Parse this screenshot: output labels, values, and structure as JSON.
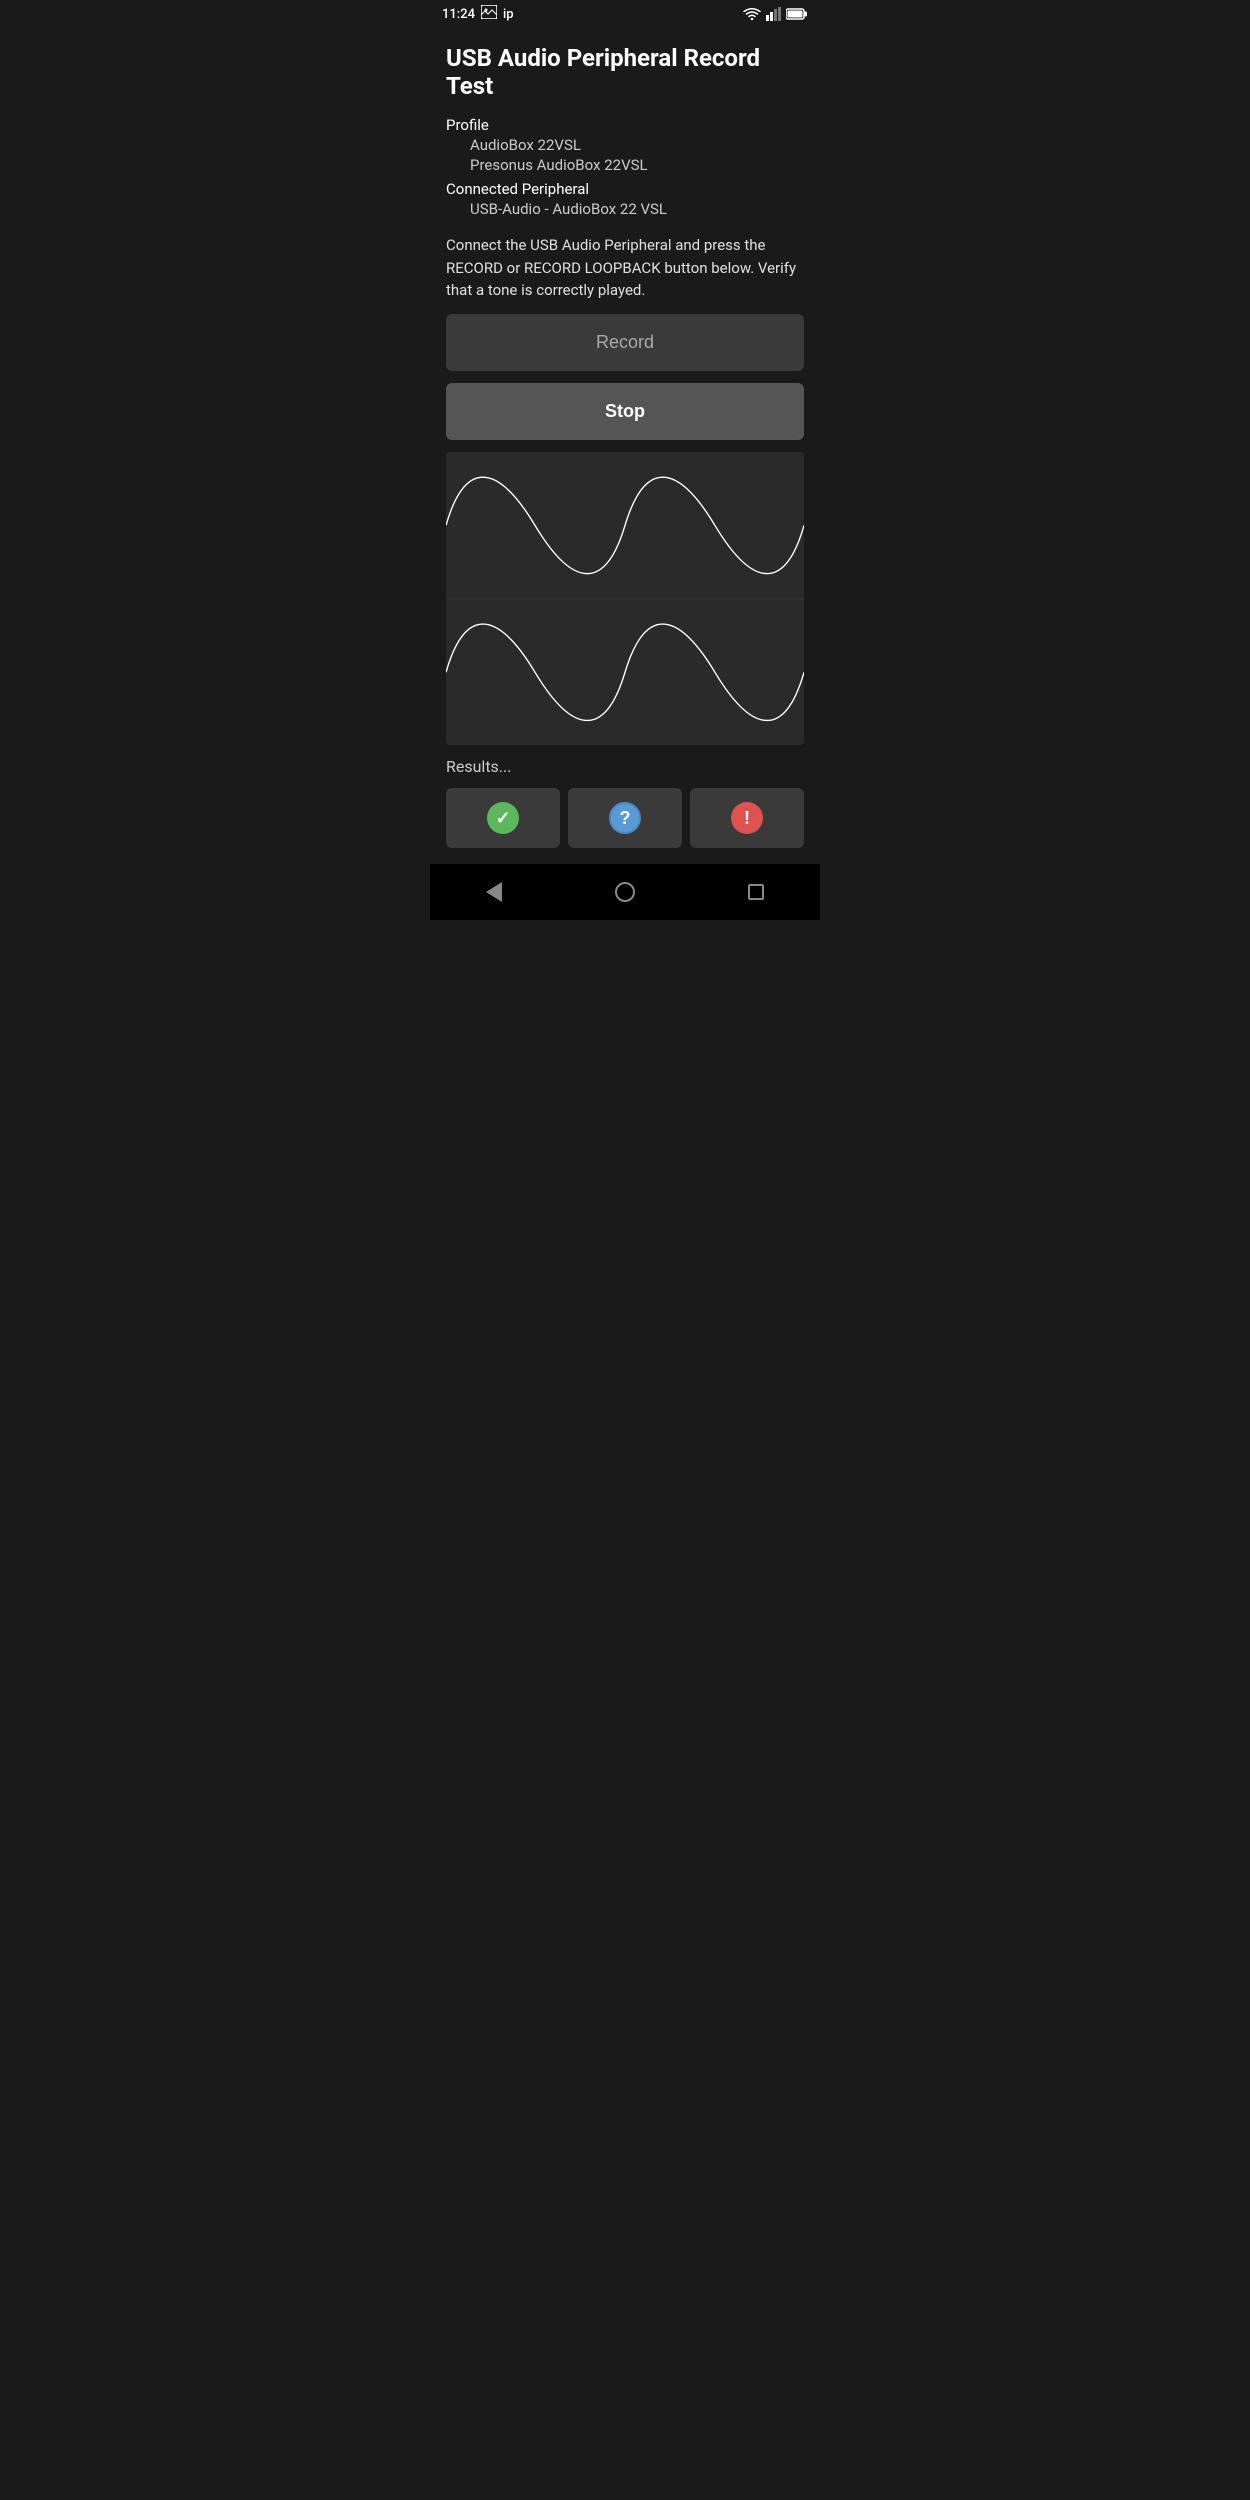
{
  "statusBar": {
    "time": "11:24",
    "imageIcon": "image",
    "ipLabel": "ip"
  },
  "header": {
    "title": "USB Audio Peripheral Record Test"
  },
  "profile": {
    "label": "Profile",
    "audioBox": "AudioBox 22VSL",
    "presonus": "Presonus AudioBox 22VSL",
    "connectedLabel": "Connected Peripheral",
    "connectedValue": "USB-Audio - AudioBox 22 VSL"
  },
  "instruction": {
    "text": "Connect the USB Audio Peripheral and press the RECORD or RECORD LOOPBACK button below. Verify that a tone is correctly played."
  },
  "buttons": {
    "record": "Record",
    "stop": "Stop"
  },
  "results": {
    "label": "Results..."
  },
  "resultButtons": [
    {
      "type": "green",
      "symbol": "✓"
    },
    {
      "type": "blue",
      "symbol": "?"
    },
    {
      "type": "red",
      "symbol": "!"
    }
  ],
  "colors": {
    "background": "#1a1a1a",
    "cardBackground": "#2a2a2a",
    "buttonBackground": "#3a3a3a",
    "stopButton": "#555555",
    "accent": "#ffffff"
  },
  "waveform": {
    "channel1": "sine",
    "channel2": "sine"
  }
}
